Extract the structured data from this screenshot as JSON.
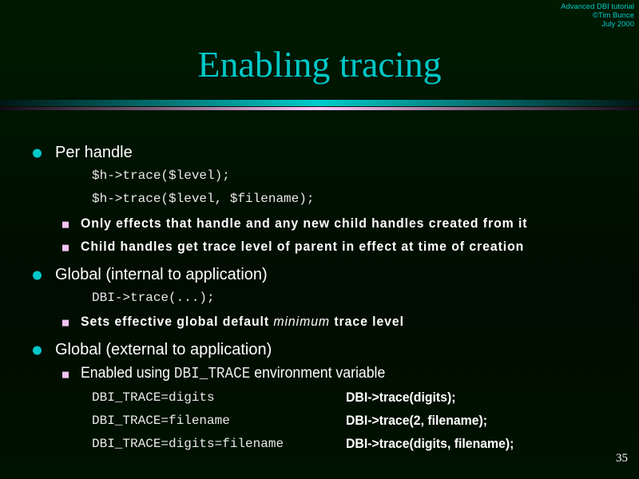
{
  "header": {
    "line1": "Advanced DBI tutorial",
    "line2": "©Tim Bunce",
    "line3": "July 2000"
  },
  "title": "Enabling tracing",
  "sections": [
    {
      "label": "Per handle",
      "code": [
        "$h->trace($level);",
        "$h->trace($level, $filename);"
      ],
      "points": [
        "Only effects that handle and any new child handles created from it",
        "Child handles get trace level of parent in effect at time of creation"
      ]
    },
    {
      "label": "Global (internal to application)",
      "code": [
        "DBI->trace(...);"
      ],
      "point_pre": "Sets effective global default ",
      "point_em": "minimum",
      "point_post": " trace level"
    },
    {
      "label": "Global (external to application)",
      "point_pre": "Enabled using ",
      "point_code": "DBI_TRACE",
      "point_post": " environment variable",
      "table": [
        [
          "DBI_TRACE=digits",
          "DBI->trace(digits);"
        ],
        [
          "DBI_TRACE=filename",
          "DBI->trace(2, filename);"
        ],
        [
          "DBI_TRACE=digits=filename",
          "DBI->trace(digits, filename);"
        ]
      ]
    }
  ],
  "page_number": "35"
}
